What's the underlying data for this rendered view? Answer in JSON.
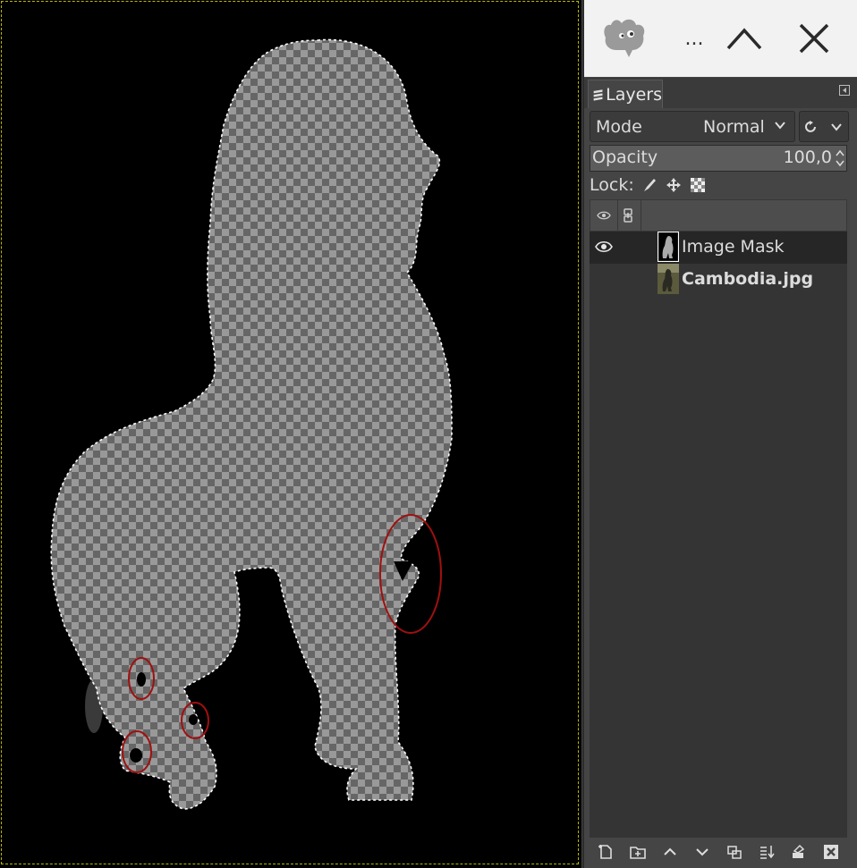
{
  "window": {
    "overflow_label": "...",
    "controls": [
      "maximize-icon",
      "close-icon"
    ]
  },
  "dock": {
    "tab_label": "Layers"
  },
  "layers_panel": {
    "mode_label": "Mode",
    "mode_value": "Normal",
    "opacity_label": "Opacity",
    "opacity_value": "100,0",
    "lock_label": "Lock:",
    "layers": [
      {
        "name": "Image Mask",
        "visible": true,
        "selected": true,
        "bold": false
      },
      {
        "name": "Cambodia.jpg",
        "visible": false,
        "selected": false,
        "bold": true
      }
    ],
    "bottom_icons": [
      "new-layer-icon",
      "new-group-icon",
      "raise-layer-icon",
      "lower-layer-icon",
      "duplicate-layer-icon",
      "merge-down-icon",
      "add-mask-icon",
      "delete-layer-icon"
    ]
  },
  "colors": {
    "selection_outline": "#ffffff",
    "annotation_circle": "#a01010",
    "canvas_background": "#000000"
  }
}
